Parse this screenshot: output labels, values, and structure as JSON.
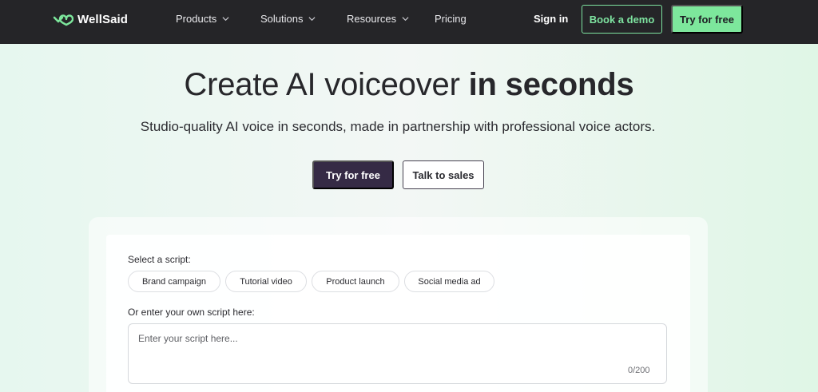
{
  "nav": {
    "logo_text": "WellSaid",
    "items": [
      {
        "label": "Products"
      },
      {
        "label": "Solutions"
      },
      {
        "label": "Resources"
      },
      {
        "label": "Pricing"
      }
    ],
    "sign_in": "Sign in",
    "book_demo": "Book a demo",
    "try_free": "Try for free"
  },
  "hero": {
    "title_regular": "Create AI voiceover ",
    "title_bold": "in seconds",
    "subtitle": "Studio-quality AI voice in seconds, made in partnership with professional voice actors.",
    "try_free": "Try for free",
    "talk_sales": "Talk to sales"
  },
  "demo": {
    "select_label": "Select a script:",
    "chips": [
      {
        "label": "Brand campaign"
      },
      {
        "label": "Tutorial video"
      },
      {
        "label": "Product launch"
      },
      {
        "label": "Social media ad"
      }
    ],
    "own_label": "Or enter your own script here:",
    "placeholder": "Enter your script here...",
    "counter": "0/200"
  },
  "colors": {
    "nav_bg": "#252528",
    "accent_green": "#7de79c",
    "primary_dark": "#352a45"
  }
}
